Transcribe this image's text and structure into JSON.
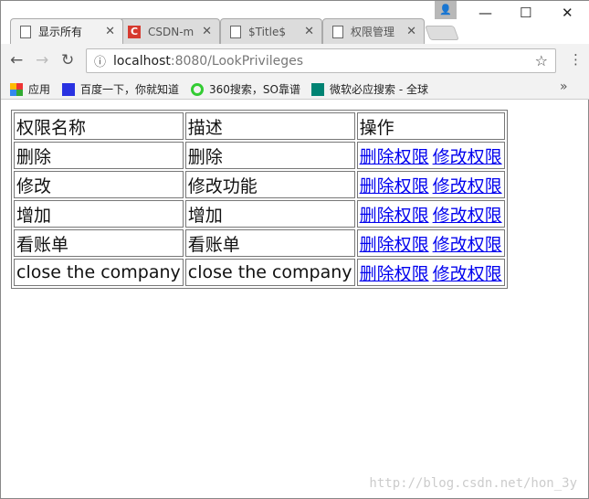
{
  "browser": {
    "tabs": [
      {
        "title": "显示所有",
        "icon": "page-icon"
      },
      {
        "title": "CSDN-m",
        "icon": "csdn-icon"
      },
      {
        "title": "$Title$",
        "icon": "page-icon"
      },
      {
        "title": "权限管理",
        "icon": "page-icon"
      }
    ],
    "url_host": "localhost",
    "url_rest": ":8080/LookPrivileges",
    "bookmarks": [
      "应用",
      "百度一下，你就知道",
      "360搜索，SO靠谱",
      "微软必应搜索 - 全球"
    ]
  },
  "table": {
    "headers": [
      "权限名称",
      "描述",
      "操作"
    ],
    "rows": [
      {
        "name": "删除",
        "desc": "删除"
      },
      {
        "name": "修改",
        "desc": "修改功能"
      },
      {
        "name": "增加",
        "desc": "增加"
      },
      {
        "name": "看账单",
        "desc": "看账单"
      },
      {
        "name": "close the company",
        "desc": "close the company"
      }
    ],
    "delete_label": "删除权限",
    "edit_label": "修改权限"
  },
  "watermark": "http://blog.csdn.net/hon_3y"
}
